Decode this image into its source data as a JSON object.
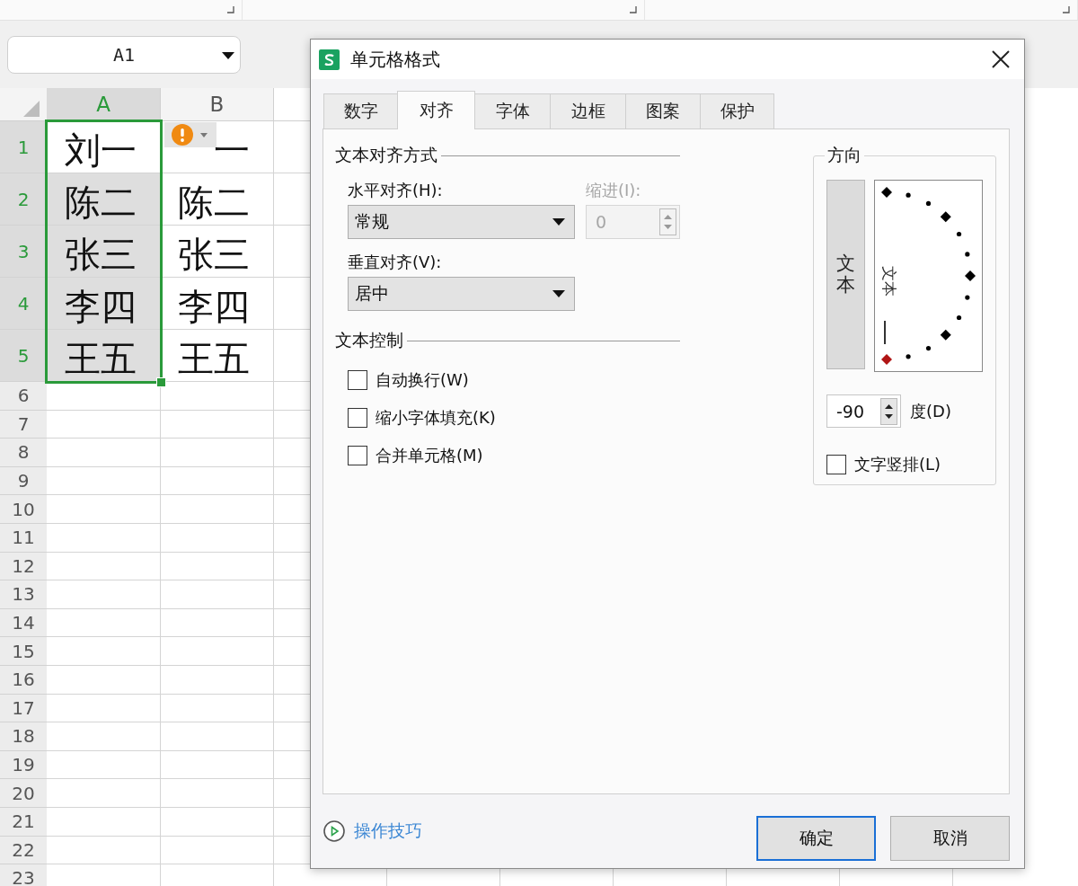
{
  "name_box": {
    "value": "A1"
  },
  "sheet": {
    "columns": [
      {
        "label": "A",
        "selected": true
      },
      {
        "label": "B",
        "selected": false
      }
    ],
    "rows": [
      {
        "label": "1",
        "selected": true,
        "cells": [
          {
            "text": "刘一",
            "selected": true,
            "active": true,
            "smart_tag": false
          },
          {
            "text": "一",
            "selected": false,
            "active": false,
            "smart_tag": true
          }
        ]
      },
      {
        "label": "2",
        "selected": true,
        "cells": [
          {
            "text": "陈二",
            "selected": true,
            "active": false,
            "smart_tag": false
          },
          {
            "text": "陈二",
            "selected": false,
            "active": false,
            "smart_tag": false
          }
        ]
      },
      {
        "label": "3",
        "selected": true,
        "cells": [
          {
            "text": "张三",
            "selected": true,
            "active": false,
            "smart_tag": false
          },
          {
            "text": "张三",
            "selected": false,
            "active": false,
            "smart_tag": false
          }
        ]
      },
      {
        "label": "4",
        "selected": true,
        "cells": [
          {
            "text": "李四",
            "selected": true,
            "active": false,
            "smart_tag": false
          },
          {
            "text": "李四",
            "selected": false,
            "active": false,
            "smart_tag": false
          }
        ]
      },
      {
        "label": "5",
        "selected": true,
        "cells": [
          {
            "text": "王五",
            "selected": true,
            "active": false,
            "smart_tag": false
          },
          {
            "text": "王五",
            "selected": false,
            "active": false,
            "smart_tag": false
          }
        ]
      },
      {
        "label": "6",
        "selected": false,
        "cells": []
      },
      {
        "label": "7",
        "selected": false,
        "cells": []
      },
      {
        "label": "8",
        "selected": false,
        "cells": []
      },
      {
        "label": "9",
        "selected": false,
        "cells": []
      },
      {
        "label": "10",
        "selected": false,
        "cells": []
      },
      {
        "label": "11",
        "selected": false,
        "cells": []
      },
      {
        "label": "12",
        "selected": false,
        "cells": []
      },
      {
        "label": "13",
        "selected": false,
        "cells": []
      },
      {
        "label": "14",
        "selected": false,
        "cells": []
      },
      {
        "label": "15",
        "selected": false,
        "cells": []
      },
      {
        "label": "16",
        "selected": false,
        "cells": []
      },
      {
        "label": "17",
        "selected": false,
        "cells": []
      },
      {
        "label": "18",
        "selected": false,
        "cells": []
      },
      {
        "label": "19",
        "selected": false,
        "cells": []
      },
      {
        "label": "20",
        "selected": false,
        "cells": []
      },
      {
        "label": "21",
        "selected": false,
        "cells": []
      },
      {
        "label": "22",
        "selected": false,
        "cells": []
      },
      {
        "label": "23",
        "selected": false,
        "cells": []
      }
    ]
  },
  "dialog": {
    "title": "单元格格式",
    "tabs": [
      {
        "label": "数字",
        "selected": false
      },
      {
        "label": "对齐",
        "selected": true
      },
      {
        "label": "字体",
        "selected": false
      },
      {
        "label": "边框",
        "selected": false
      },
      {
        "label": "图案",
        "selected": false
      },
      {
        "label": "保护",
        "selected": false
      }
    ],
    "alignment": {
      "heading": "文本对齐方式",
      "horizontal": {
        "label": "水平对齐(H):",
        "value": "常规"
      },
      "indent": {
        "label": "缩进(I):",
        "value": "0",
        "disabled": true
      },
      "vertical": {
        "label": "垂直对齐(V):",
        "value": "居中"
      }
    },
    "text_control": {
      "heading": "文本控制",
      "options": [
        {
          "label": "自动换行(W)",
          "checked": false
        },
        {
          "label": "缩小字体填充(K)",
          "checked": false
        },
        {
          "label": "合并单元格(M)",
          "checked": false
        }
      ]
    },
    "orientation": {
      "heading": "方向",
      "vertical_text_button": "文本",
      "dial_text": "文本",
      "dial_marks": [
        {
          "kind": "diamond",
          "selected": false
        },
        {
          "kind": "dot",
          "selected": false
        },
        {
          "kind": "dot",
          "selected": false
        },
        {
          "kind": "diamond",
          "selected": false
        },
        {
          "kind": "dot",
          "selected": false
        },
        {
          "kind": "dot",
          "selected": false
        },
        {
          "kind": "diamond",
          "selected": false
        },
        {
          "kind": "dot",
          "selected": false
        },
        {
          "kind": "dot",
          "selected": false
        },
        {
          "kind": "diamond",
          "selected": false
        },
        {
          "kind": "dot",
          "selected": false
        },
        {
          "kind": "dot",
          "selected": false
        },
        {
          "kind": "diamond",
          "selected": true
        }
      ],
      "degrees": {
        "value": "-90",
        "label": "度(D)"
      },
      "stacked": {
        "label": "文字竖排(L)",
        "checked": false
      }
    },
    "tips_link": "操作技巧",
    "buttons": [
      {
        "label": "确定",
        "default": true
      },
      {
        "label": "取消",
        "default": false
      }
    ]
  }
}
